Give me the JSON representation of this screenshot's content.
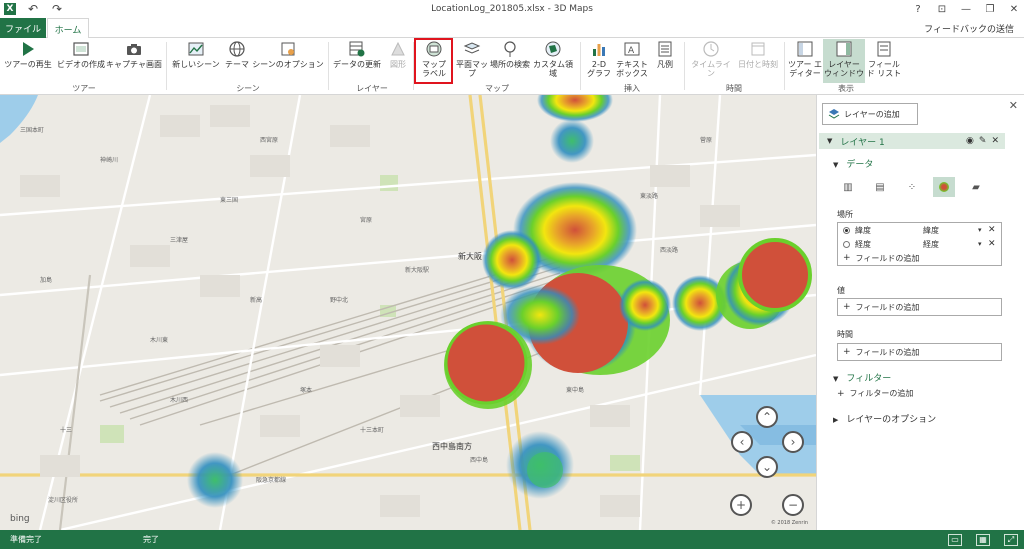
{
  "window": {
    "title": "LocationLog_201805.xlsx - 3D Maps",
    "help": "?",
    "controls": [
      "⊡",
      "—",
      "❐",
      "✕"
    ]
  },
  "tabs": {
    "file": "ファイル",
    "home": "ホーム",
    "feedback": "フィードバックの送信"
  },
  "ribbon": {
    "buttons": {
      "play_tour": "ツアーの再生",
      "create_video": "ビデオの作成",
      "capture_screen": "キャプチャ画面",
      "new_scene": "新しいシーン",
      "theme": "テーマ",
      "scene_options": "シーンのオプション",
      "refresh_data": "データの更新",
      "shapes": "図形",
      "map_labels_1": "マップ",
      "map_labels_2": "ラベル",
      "flat_map": "平面マップ",
      "find_location": "場所の検索",
      "custom_regions": "カスタム領域",
      "chart_2d_1": "2-D",
      "chart_2d_2": "グラフ",
      "textbox_1": "テキスト",
      "textbox_2": "ボックス",
      "legend": "凡例",
      "timeline": "タイムライン",
      "date_time": "日付と時刻",
      "tour_editor_1": "ツアー エ",
      "tour_editor_2": "ディター",
      "layer_pane_1": "レイヤー",
      "layer_pane_2": "ウィンドウ",
      "field_list_1": "フィール",
      "field_list_2": "ド リスト"
    },
    "groups": {
      "tour": "ツアー",
      "scene": "シーン",
      "layer": "レイヤー",
      "map": "マップ",
      "insert": "挿入",
      "time": "時間",
      "view": "表示"
    }
  },
  "map": {
    "labels": {
      "station": "新大阪",
      "east": "西中島南方",
      "south": "東中島",
      "north": "東淡路",
      "center": "新大阪駅",
      "rail": "阪急京都線",
      "junction": "西中島",
      "ward": "淀川区役所",
      "district1": "宮原",
      "district2": "西宮原",
      "district3": "三国本町",
      "district4": "十三",
      "district5": "木川東",
      "district6": "東三国",
      "district7": "西淡路",
      "district8": "菅原",
      "district9": "木川西",
      "district10": "野中北",
      "district11": "加島",
      "district12": "新高",
      "district13": "神崎川",
      "district14": "三津屋",
      "district15": "塚本",
      "district16": "十三本町"
    },
    "heat_colors": {
      "low": "#2f8dbf",
      "mid": "#6ad02c",
      "high": "#f2e60f",
      "peak": "#d0503a"
    },
    "bing": "bing",
    "copyright": "© 2018 Zenrin"
  },
  "panel": {
    "add_layer": "レイヤーの追加",
    "layer_name": "レイヤー 1",
    "data_header": "データ",
    "location_label": "場所",
    "location_fields": [
      {
        "name": "緯度",
        "type": "緯度",
        "selected": true
      },
      {
        "name": "経度",
        "type": "経度",
        "selected": false
      }
    ],
    "add_field": "フィールドの追加",
    "value_label": "値",
    "time_label": "時間",
    "filter_header": "フィルター",
    "add_filter": "フィルターの追加",
    "layer_options": "レイヤーのオプション"
  },
  "status": {
    "ready": "準備完了",
    "done": "完了"
  }
}
